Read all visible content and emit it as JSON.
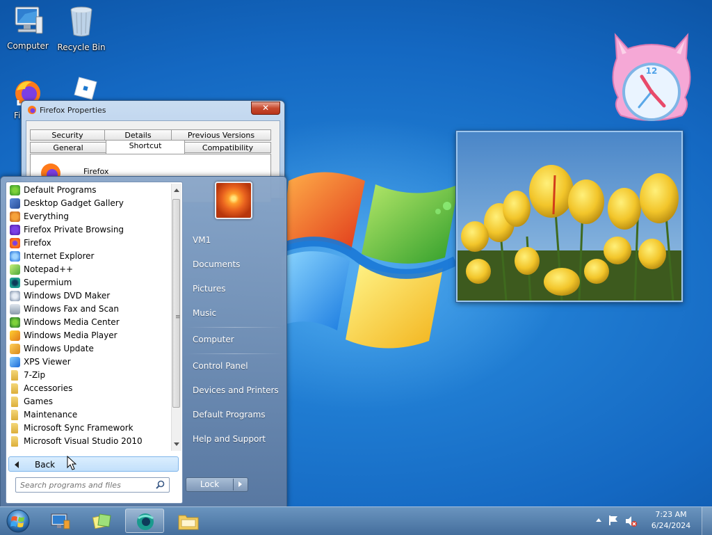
{
  "desktop": {
    "icons": [
      {
        "label": "Computer"
      },
      {
        "label": "Recycle Bin"
      },
      {
        "label": "Fi"
      }
    ]
  },
  "properties_dialog": {
    "title": "Firefox Properties",
    "tabs_row1": [
      "Security",
      "Details",
      "Previous Versions"
    ],
    "tabs_row2": [
      "General",
      "Shortcut",
      "Compatibility"
    ],
    "active_tab": "Shortcut",
    "item_name": "Firefox"
  },
  "start_menu": {
    "programs": [
      {
        "label": "Default Programs",
        "icon": "default-programs-icon"
      },
      {
        "label": "Desktop Gadget Gallery",
        "icon": "gadget-gallery-icon"
      },
      {
        "label": "Everything",
        "icon": "everything-search-icon"
      },
      {
        "label": "Firefox Private Browsing",
        "icon": "firefox-private-icon"
      },
      {
        "label": "Firefox",
        "icon": "firefox-icon"
      },
      {
        "label": "Internet Explorer",
        "icon": "internet-explorer-icon"
      },
      {
        "label": "Notepad++",
        "icon": "notepadpp-icon"
      },
      {
        "label": "Supermium",
        "icon": "supermium-icon"
      },
      {
        "label": "Windows DVD Maker",
        "icon": "dvd-maker-icon"
      },
      {
        "label": "Windows Fax and Scan",
        "icon": "fax-scan-icon"
      },
      {
        "label": "Windows Media Center",
        "icon": "media-center-icon"
      },
      {
        "label": "Windows Media Player",
        "icon": "media-player-icon"
      },
      {
        "label": "Windows Update",
        "icon": "windows-update-icon"
      },
      {
        "label": "XPS Viewer",
        "icon": "xps-viewer-icon"
      },
      {
        "label": "7-Zip",
        "icon": "folder-icon"
      },
      {
        "label": "Accessories",
        "icon": "folder-icon"
      },
      {
        "label": "Games",
        "icon": "folder-icon"
      },
      {
        "label": "Maintenance",
        "icon": "folder-icon"
      },
      {
        "label": "Microsoft Sync Framework",
        "icon": "folder-icon"
      },
      {
        "label": "Microsoft Visual Studio 2010",
        "icon": "folder-icon"
      }
    ],
    "back_label": "Back",
    "search_placeholder": "Search programs and files",
    "right_links": {
      "user": "VM1",
      "documents": "Documents",
      "pictures": "Pictures",
      "music": "Music",
      "computer": "Computer",
      "control_panel": "Control Panel",
      "devices": "Devices and Printers",
      "default_programs": "Default Programs",
      "help": "Help and Support"
    },
    "lock_label": "Lock"
  },
  "taskbar": {
    "time": "7:23 AM",
    "date": "6/24/2024"
  },
  "colors": {
    "desktop_blue": "#1c78cf",
    "selection_blue": "#c2e0fb"
  }
}
